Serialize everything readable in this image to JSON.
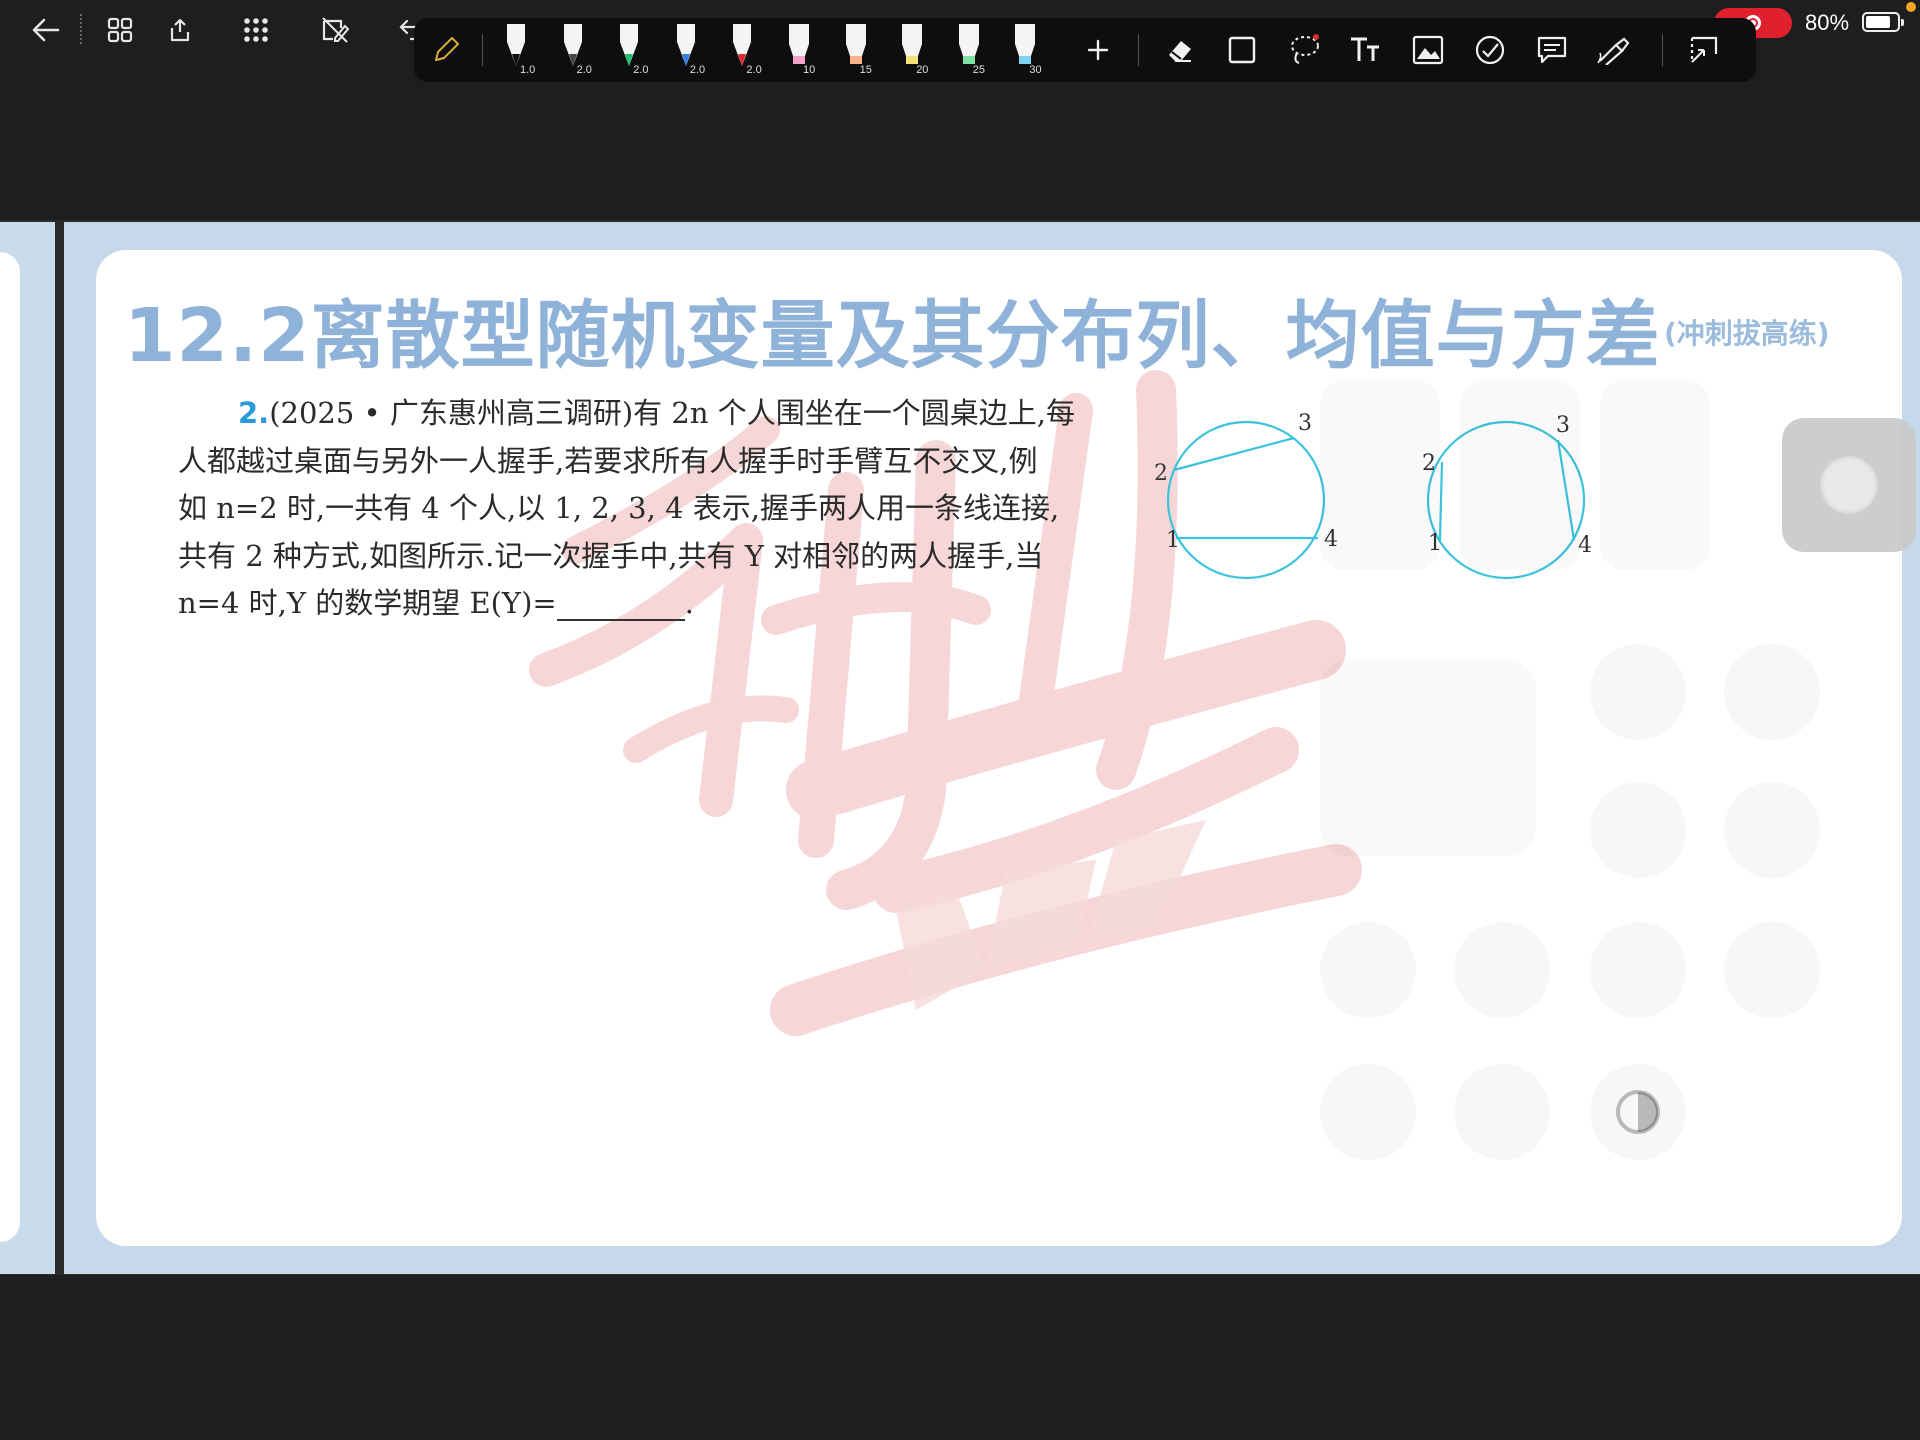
{
  "status_bar": {
    "battery_percent": "80%",
    "battery_level": 0.8,
    "recording_color": "#e0202c"
  },
  "top_nav": {
    "icons": [
      "back-arrow-icon",
      "grid-view-icon",
      "export-icon",
      "apps-icon",
      "edit-off-icon",
      "undo-icon"
    ]
  },
  "pen_toolbar": {
    "pens": [
      {
        "name": "black-pen",
        "size": "1.0",
        "color": "#111111"
      },
      {
        "name": "gray-pen",
        "size": "2.0",
        "color": "#444444"
      },
      {
        "name": "green-pen",
        "size": "2.0",
        "color": "#1fbf6b"
      },
      {
        "name": "blue-pen",
        "size": "2.0",
        "color": "#2f7fe0"
      },
      {
        "name": "red-pen",
        "size": "2.0",
        "color": "#e02a2a"
      },
      {
        "name": "pink-highlighter",
        "size": "10",
        "color": "#f4a3c8"
      },
      {
        "name": "peach-highlighter",
        "size": "15",
        "color": "#f7b38a"
      },
      {
        "name": "yellow-highlighter",
        "size": "20",
        "color": "#f2e27a"
      },
      {
        "name": "green-highlighter",
        "size": "25",
        "color": "#7fe0a4"
      },
      {
        "name": "cyan-highlighter",
        "size": "30",
        "color": "#7fd3f0"
      }
    ],
    "tools": [
      "add-icon",
      "eraser-icon",
      "shape-icon",
      "lasso-icon",
      "text-icon",
      "image-icon",
      "sticker-icon",
      "comment-icon",
      "laser-pointer-icon",
      "crop-icon"
    ]
  },
  "page": {
    "title": "12.2离散型随机变量及其分布列、均值与方差",
    "subtitle": "(冲刺拔高练)",
    "problem": {
      "number": "2.",
      "line1": "(2025 • 广东惠州高三调研)有 2n 个人围坐在一个圆桌边上,每",
      "line2": "人都越过桌面与另外一人握手,若要求所有人握手时手臂互不交叉,例",
      "line3": "如 n=2 时,一共有 4 个人,以 1, 2, 3, 4 表示,握手两人用一条线连接,",
      "line4": "共有 2 种方式,如图所示.记一次握手中,共有 Y 对相邻的两人握手,当",
      "line5_a": "n=4 时,Y 的数学期望 E(Y)=",
      "line5_b": "."
    },
    "figures": [
      {
        "labels": [
          "1",
          "2",
          "3",
          "4"
        ]
      },
      {
        "labels": [
          "1",
          "2",
          "3",
          "4"
        ]
      }
    ],
    "accent_color": "#3bc3dc"
  }
}
